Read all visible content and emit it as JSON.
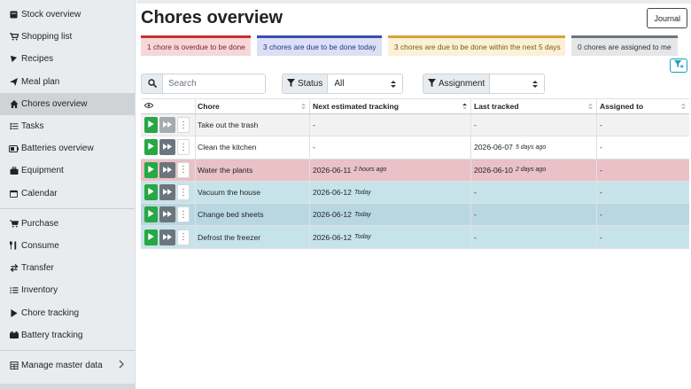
{
  "sidebar": {
    "items": [
      {
        "label": "Stock overview",
        "icon": "box-icon"
      },
      {
        "label": "Shopping list",
        "icon": "cart-icon"
      },
      {
        "label": "Recipes",
        "icon": "pizza-icon"
      },
      {
        "label": "Meal plan",
        "icon": "paper-plane-icon"
      },
      {
        "label": "Chores overview",
        "icon": "home-icon"
      },
      {
        "label": "Tasks",
        "icon": "tasks-icon"
      },
      {
        "label": "Batteries overview",
        "icon": "battery-icon"
      },
      {
        "label": "Equipment",
        "icon": "toolbox-icon"
      },
      {
        "label": "Calendar",
        "icon": "calendar-icon"
      },
      {
        "label": "Purchase",
        "icon": "cart-plus-icon"
      },
      {
        "label": "Consume",
        "icon": "utensils-icon"
      },
      {
        "label": "Transfer",
        "icon": "exchange-icon"
      },
      {
        "label": "Inventory",
        "icon": "list-icon"
      },
      {
        "label": "Chore tracking",
        "icon": "play-icon"
      },
      {
        "label": "Battery tracking",
        "icon": "car-battery-icon"
      },
      {
        "label": "Manage master data",
        "icon": "table-icon"
      }
    ]
  },
  "page": {
    "title": "Chores overview",
    "journal_label": "Journal"
  },
  "badges": {
    "overdue": "1 chore is overdue to be done",
    "today": "3 chores are due to be done today",
    "soon": "3 chores are due to be done within the next 5 days",
    "assigned": "0 chores are assigned to me"
  },
  "filters": {
    "search_placeholder": "Search",
    "status_label": "Status",
    "status_value": "All",
    "assignment_label": "Assignment",
    "assignment_value": ""
  },
  "table": {
    "headers": [
      "Chore",
      "Next estimated tracking",
      "Last tracked",
      "Assigned to"
    ],
    "rows": [
      {
        "chore": "Take out the trash",
        "next": "-",
        "next_rel": "",
        "last": "-",
        "last_rel": "",
        "assigned": "-"
      },
      {
        "chore": "Clean the kitchen",
        "next": "-",
        "next_rel": "",
        "last": "2026-06-07",
        "last_rel": "5 days ago",
        "assigned": "-"
      },
      {
        "chore": "Water the plants",
        "next": "2026-06-11",
        "next_rel": "2 hours ago",
        "last": "2026-06-10",
        "last_rel": "2 days ago",
        "assigned": "-"
      },
      {
        "chore": "Vacuum the house",
        "next": "2026-06-12",
        "next_rel": "Today",
        "last": "-",
        "last_rel": "",
        "assigned": "-"
      },
      {
        "chore": "Change bed sheets",
        "next": "2026-06-12",
        "next_rel": "Today",
        "last": "-",
        "last_rel": "",
        "assigned": "-"
      },
      {
        "chore": "Defrost the freezer",
        "next": "2026-06-12",
        "next_rel": "Today",
        "last": "-",
        "last_rel": "",
        "assigned": "-"
      }
    ]
  },
  "colors": {
    "overdue": "#c9302c",
    "today": "#3b4dab",
    "soon": "#d6a33a",
    "assigned": "#6c757d",
    "track_button": "#28a745",
    "accent": "#17a2b8"
  }
}
